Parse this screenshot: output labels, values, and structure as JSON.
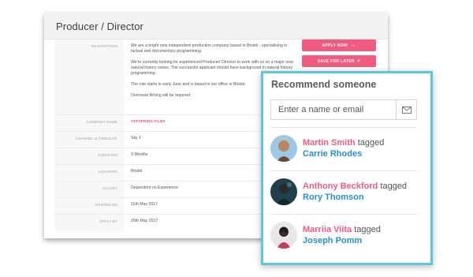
{
  "job": {
    "title": "Producer / Director",
    "description": {
      "label": "Description",
      "paragraphs": [
        "We are a bright new independent production company based in Bristol - specialising in factual and documentary programming.",
        "We're currently looking for experienced Producer/ Director to work with us on a major new natural history series. The successful applicant should have background in natural history programming.",
        "The role starts in early June and is based in our office in Bristol.",
        "Overseas filming will be required."
      ]
    },
    "fields": [
      {
        "label": "Company Name",
        "value": "Offspring Films",
        "accent": true
      },
      {
        "label": "Channel & Timeslot",
        "value": "Sky 1"
      },
      {
        "label": "Duration",
        "value": "9 Months"
      },
      {
        "label": "Location",
        "value": "Bristol"
      },
      {
        "label": "Salary",
        "value": "Dependent on Experience"
      },
      {
        "label": "Posted On",
        "value": "11th May 2017"
      },
      {
        "label": "Apply By",
        "value": "26th May 2017"
      }
    ],
    "apply_label": "Apply Now",
    "save_label": "Save for later",
    "accent_color": "#f25b80"
  },
  "recommend": {
    "title": "Recommend someone",
    "search_placeholder": "Enter a name or email",
    "border_color": "#5bc8e0",
    "items": [
      {
        "name": "Martin Smith",
        "action": "tagged",
        "target": "Carrie Rhodes"
      },
      {
        "name": "Anthony Beckford",
        "action": "tagged",
        "target": "Rory Thomson"
      },
      {
        "name": "Marriia Viita",
        "action": "tagged",
        "target": "Joseph Pomm"
      }
    ]
  }
}
